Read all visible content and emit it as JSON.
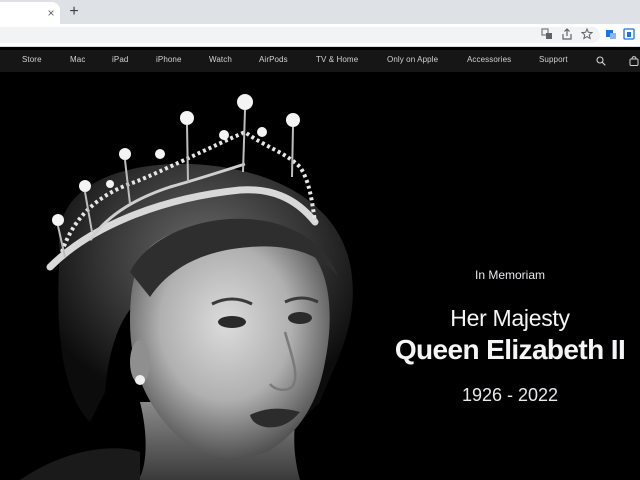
{
  "browser": {
    "tab_close": "×",
    "new_tab": "+",
    "icons": [
      "translate-icon",
      "share-icon",
      "bookmark-star-icon",
      "extension-icon",
      "profile-icon"
    ]
  },
  "nav": {
    "items": [
      {
        "label": "Store"
      },
      {
        "label": "Mac"
      },
      {
        "label": "iPad"
      },
      {
        "label": "iPhone"
      },
      {
        "label": "Watch"
      },
      {
        "label": "AirPods"
      },
      {
        "label": "TV & Home"
      },
      {
        "label": "Only on Apple"
      },
      {
        "label": "Accessories"
      },
      {
        "label": "Support"
      }
    ],
    "icons": [
      "search-icon",
      "bag-icon"
    ]
  },
  "hero": {
    "eyebrow": "In Memoriam",
    "line1": "Her Majesty",
    "line2": "Queen Elizabeth II",
    "dates": "1926 - 2022"
  },
  "colors": {
    "nav_bg": "#161617",
    "hero_bg": "#000000",
    "text": "#f5f5f7"
  }
}
